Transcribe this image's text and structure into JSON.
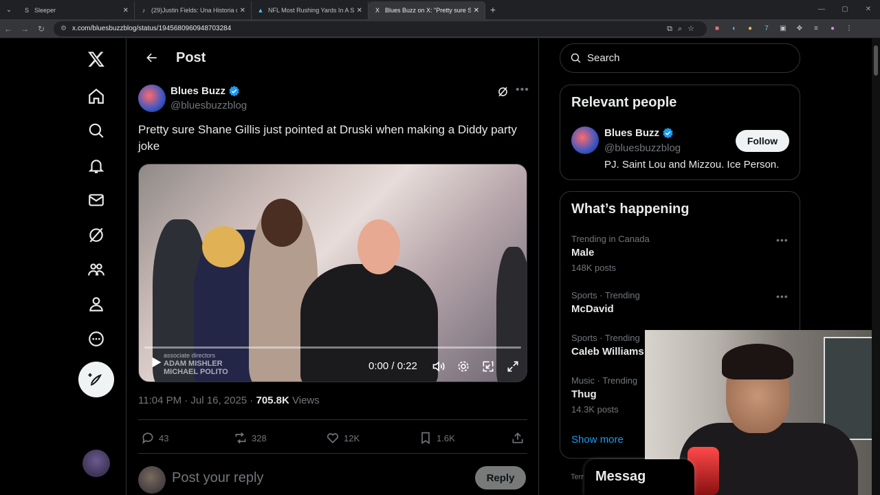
{
  "browser": {
    "tabs": [
      {
        "title": "Sleeper",
        "favicon": "S"
      },
      {
        "title": "(29)Justin Fields: Una Historia d",
        "favicon": "♪"
      },
      {
        "title": "NFL Most Rushing Yards In A S",
        "favicon": "▲"
      },
      {
        "title": "Blues Buzz on X: \"Pretty sure Sh",
        "favicon": "X"
      }
    ],
    "url": "x.com/bluesbuzzblog/status/1945680960948703284"
  },
  "header": {
    "title": "Post"
  },
  "tweet": {
    "author_name": "Blues Buzz",
    "author_handle": "@bluesbuzzblog",
    "text": "Pretty sure Shane Gillis just pointed at Druski when making a Diddy party joke",
    "video": {
      "time": "0:00 / 0:22",
      "progress": 0,
      "credit_line1": "associate directors",
      "credit_line2": "ADAM MISHLER",
      "credit_line3": "MICHAEL POLITO"
    },
    "timestamp": "11:04 PM · Jul 16, 2025 · ",
    "views_count": "705.8K",
    "views_label": " Views",
    "replies": "43",
    "reposts": "328",
    "likes": "12K",
    "bookmarks": "1.6K"
  },
  "reply": {
    "placeholder": "Post your reply",
    "button": "Reply"
  },
  "search": {
    "placeholder": "Search"
  },
  "relevant_people": {
    "title": "Relevant people",
    "name": "Blues Buzz",
    "handle": "@bluesbuzzblog",
    "bio": "PJ. Saint Lou and Mizzou. Ice Person.",
    "follow": "Follow"
  },
  "whats_happening": {
    "title": "What’s happening",
    "trends": [
      {
        "category": "Trending in Canada",
        "name": "Male",
        "count": "148K posts"
      },
      {
        "category": "Sports · Trending",
        "name": "McDavid",
        "count": ""
      },
      {
        "category": "Sports · Trending",
        "name": "Caleb Williams",
        "count": ""
      },
      {
        "category": "Music · Trending",
        "name": "Thug",
        "count": "14.3K posts"
      }
    ],
    "show_more": "Show more"
  },
  "terms": "Terr",
  "messages": "Messag",
  "colors": {
    "accent": "#1d9bf0",
    "background": "#000000",
    "border": "#2f3336",
    "muted": "#71767b"
  }
}
